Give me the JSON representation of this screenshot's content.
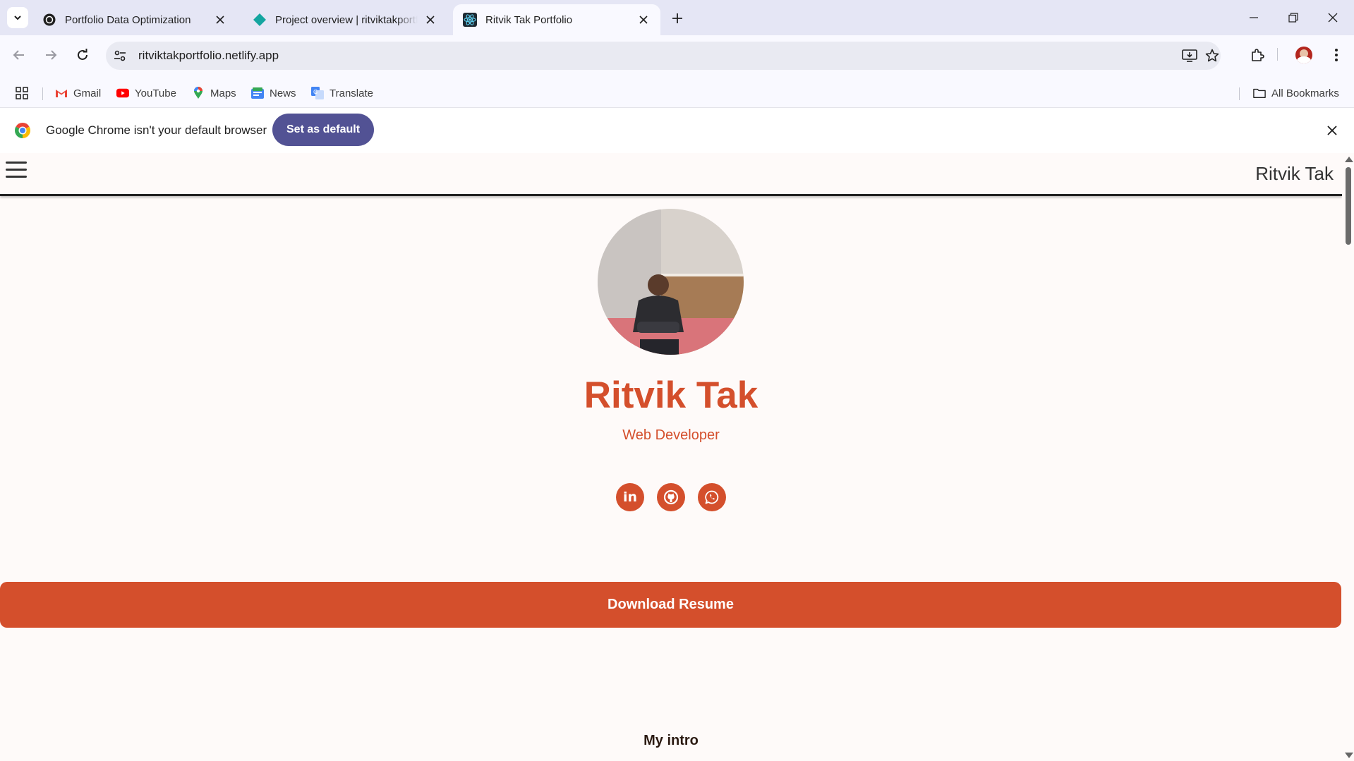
{
  "browser": {
    "tabs": [
      {
        "title": "Portfolio Data Optimization",
        "icon": "openai-icon",
        "active": false
      },
      {
        "title": "Project overview | ritviktakportfolio",
        "icon": "netlify-icon",
        "active": false
      },
      {
        "title": "Ritvik Tak Portfolio",
        "icon": "react-icon",
        "active": true
      }
    ],
    "url": "ritviktakportfolio.netlify.app",
    "bookmarks": [
      {
        "label": "Gmail",
        "icon": "gmail-icon"
      },
      {
        "label": "YouTube",
        "icon": "youtube-icon"
      },
      {
        "label": "Maps",
        "icon": "maps-icon"
      },
      {
        "label": "News",
        "icon": "news-icon"
      },
      {
        "label": "Translate",
        "icon": "translate-icon"
      }
    ],
    "all_bookmarks": "All Bookmarks",
    "infobar": {
      "message": "Google Chrome isn't your default browser",
      "button": "Set as default"
    }
  },
  "page": {
    "header_brand": "Ritvik Tak",
    "name": "Ritvik Tak",
    "role": "Web Developer",
    "social": [
      {
        "label": "in",
        "icon": "linkedin-icon"
      },
      {
        "label": "",
        "icon": "github-icon"
      },
      {
        "label": "",
        "icon": "whatsapp-icon"
      }
    ],
    "download_label": "Download Resume",
    "intro_heading": "My intro",
    "accent_color": "#d44f2c"
  }
}
